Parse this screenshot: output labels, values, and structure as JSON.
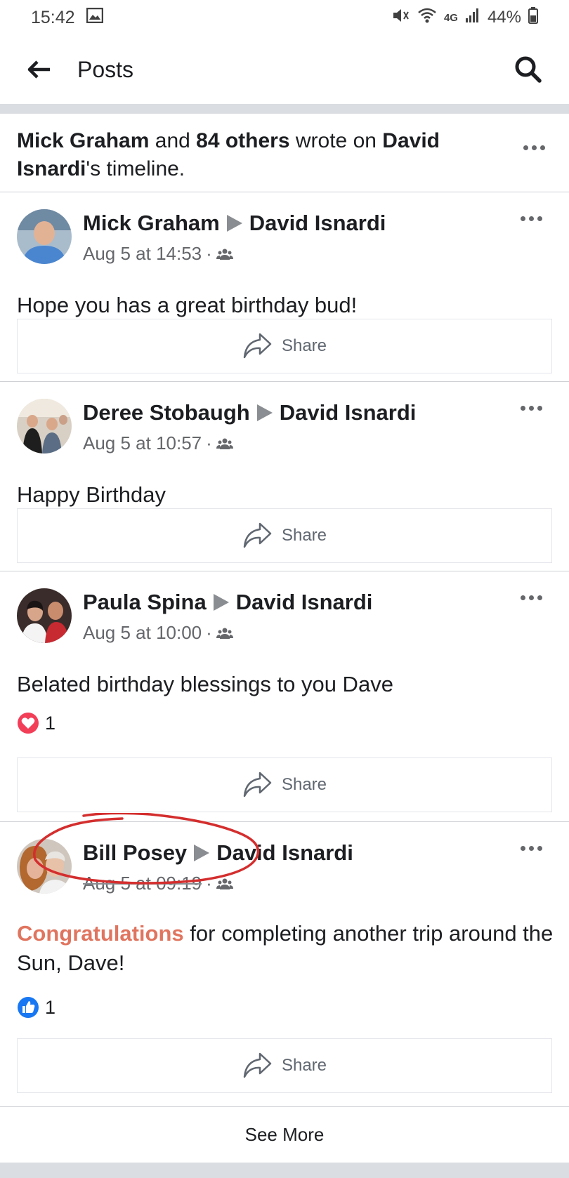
{
  "status_bar": {
    "time": "15:42",
    "battery": "44%",
    "network": "4G"
  },
  "app_bar": {
    "title": "Posts"
  },
  "summary": {
    "name1": "Mick Graham",
    "and": " and ",
    "others": "84 others",
    "wrote_on": " wrote on ",
    "target": "David Isnardi",
    "suffix": "'s timeline."
  },
  "posts": [
    {
      "author": "Mick Graham",
      "target": "David Isnardi",
      "time": "Aug 5 at 14:53",
      "text": "Hope you has a great birthday bud!",
      "share": "Share"
    },
    {
      "author": "Deree Stobaugh",
      "target": "David Isnardi",
      "time": "Aug 5 at 10:57",
      "text": "Happy Birthday",
      "share": "Share"
    },
    {
      "author": "Paula Spina",
      "target": "David Isnardi",
      "time": "Aug 5 at 10:00",
      "text": "Belated birthday blessings to you Dave",
      "reaction_count": "1",
      "reaction_type": "love",
      "share": "Share"
    },
    {
      "author": "Bill Posey",
      "target": "David Isnardi",
      "time": "Aug 5 at 09:19",
      "text_highlight": "Congratulations",
      "text_rest": " for completing another trip around the Sun, Dave!",
      "reaction_count": "1",
      "reaction_type": "like",
      "share": "Share"
    }
  ],
  "see_more": "See More",
  "colors": {
    "love": "#f33e58",
    "like": "#1877f2",
    "highlight": "#e0755f",
    "annotation": "#d42e2e"
  }
}
